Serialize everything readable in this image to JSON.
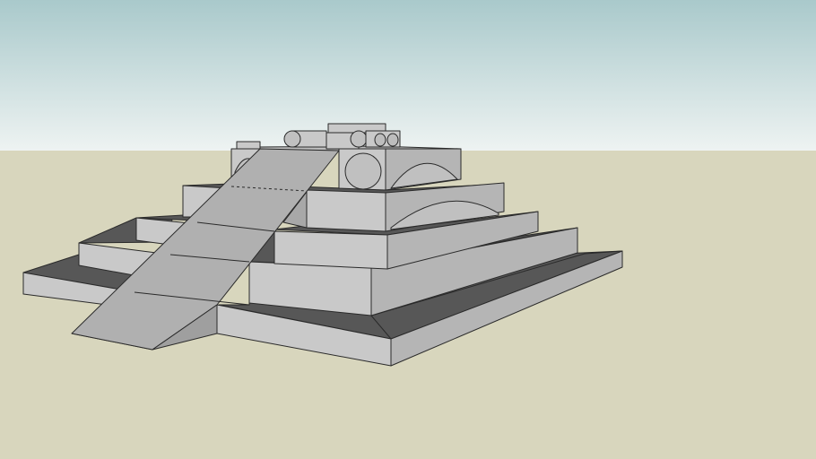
{
  "scene": {
    "type": "3d-model-viewport",
    "subject": "stepped-pyramid-with-ramp",
    "colors": {
      "sky_top": "#a9c9cb",
      "sky_bottom": "#eef3f2",
      "ground": "#d8d6bd",
      "face_light": "#c9c9c9",
      "face_mid": "#b5b5b5",
      "face_dark": "#575757",
      "ramp": "#b0b0b0",
      "edge": "#2a2a2a"
    },
    "tiers": 4
  }
}
